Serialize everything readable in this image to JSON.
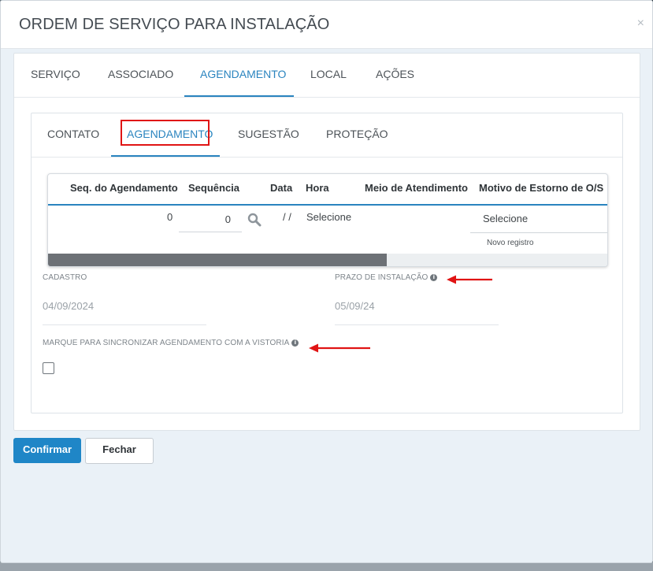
{
  "modal": {
    "title": "ORDEM DE SERVIÇO PARA INSTALAÇÃO",
    "close_icon": "×"
  },
  "outer_tabs": [
    {
      "label": "SERVIÇO",
      "active": false
    },
    {
      "label": "ASSOCIADO",
      "active": false
    },
    {
      "label": "AGENDAMENTO",
      "active": true
    },
    {
      "label": "LOCAL",
      "active": false
    },
    {
      "label": "AÇÕES",
      "active": false
    }
  ],
  "inner_tabs": [
    {
      "label": "CONTATO",
      "active": false
    },
    {
      "label": "AGENDAMENTO",
      "active": true
    },
    {
      "label": "SUGESTÃO",
      "active": false
    },
    {
      "label": "PROTEÇÃO",
      "active": false
    }
  ],
  "grid": {
    "columns": [
      "Seq. do Agendamento",
      "Sequência",
      "Data",
      "Hora",
      "Meio de Atendimento",
      "Motivo de Estorno de O/S"
    ],
    "row": {
      "seq_agendamento": "0",
      "sequencia": "0",
      "data": "/ /",
      "hora": "Selecione",
      "motivo": "Selecione"
    },
    "novo_registro": "Novo registro"
  },
  "fields": {
    "cadastro_label": "CADASTRO",
    "cadastro_value": "04/09/2024",
    "prazo_label": "PRAZO DE INSTALAÇÃO",
    "prazo_value": "05/09/24",
    "sync_label": "MARQUE PARA SINCRONIZAR AGENDAMENTO COM A VISTORIA",
    "sync_checked": false
  },
  "info_glyph": "i",
  "buttons": {
    "confirm": "Confirmar",
    "close": "Fechar"
  },
  "colors": {
    "accent": "#2a84bf",
    "primary_button": "#1f86c7",
    "annotation_red": "#e01414"
  },
  "icons": {
    "search": "search-icon",
    "info": "info-icon",
    "close": "close-icon",
    "arrow": "red-arrow-annotation"
  }
}
